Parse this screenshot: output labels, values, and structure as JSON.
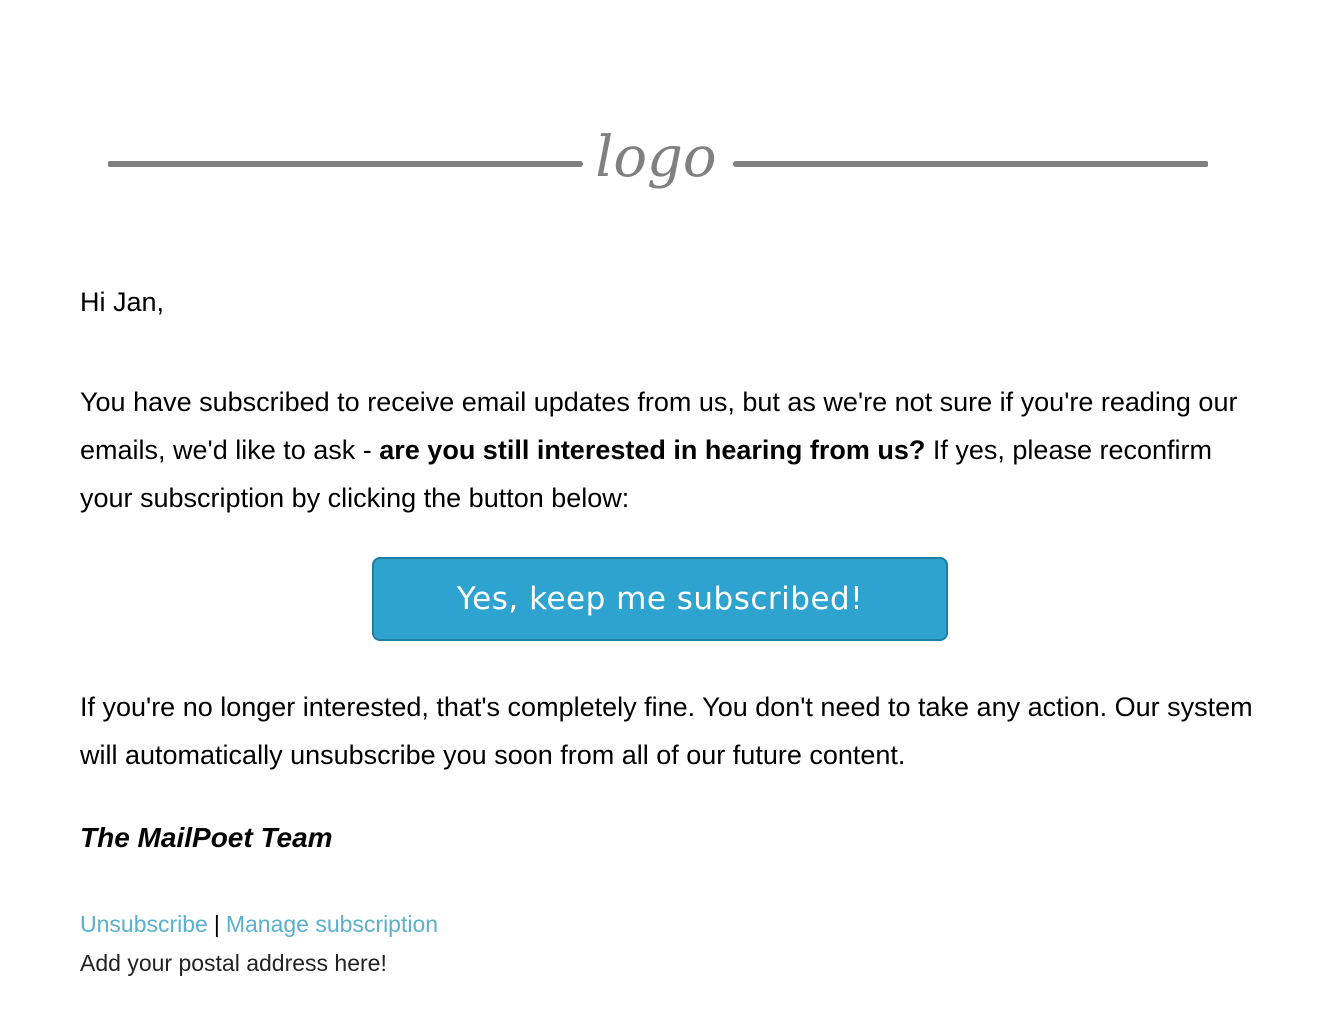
{
  "header": {
    "logo_text": "logo",
    "line_color": "#808080"
  },
  "body": {
    "greeting": "Hi Jan,",
    "intro_part1": "You have subscribed to receive email updates from us, but as we're not sure if you're reading our emails, we'd like to ask - ",
    "intro_bold": "are you still interested in hearing from us?",
    "intro_part2": " If yes, please reconfirm your subscription by clicking the button below:",
    "cta_label": "Yes, keep me subscribed!",
    "outro": "If you're no longer interested, that's completely fine. You don't need to take any action. Our system will automatically unsubscribe you soon from all of our future content.",
    "signature": "The MailPoet Team"
  },
  "footer": {
    "unsubscribe_label": "Unsubscribe",
    "separator": "|",
    "manage_label": "Manage subscription",
    "postal_address": "Add your postal address here!"
  },
  "colors": {
    "button_bg": "#2ea3d0",
    "button_border": "#1e7ea6",
    "link": "#5ab0cf"
  }
}
